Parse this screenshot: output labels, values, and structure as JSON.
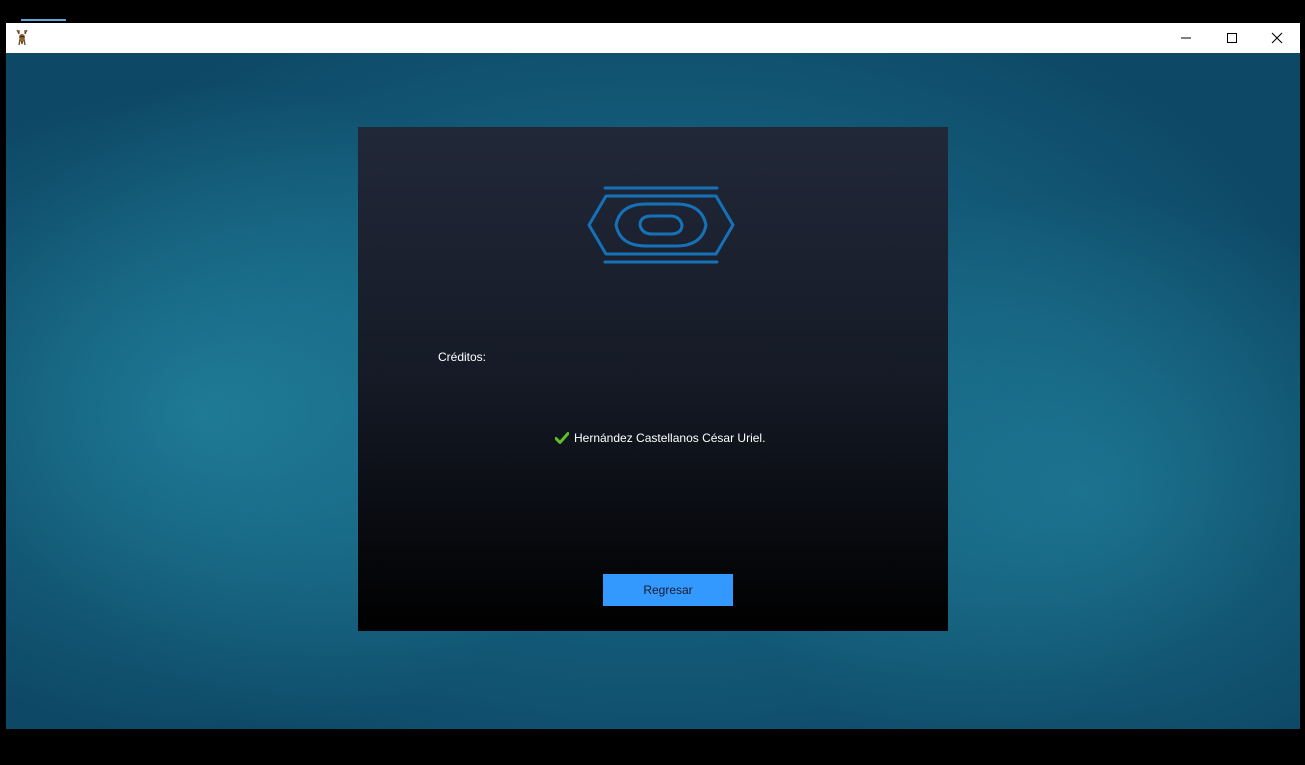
{
  "titlebar": {
    "app_icon": "deer-icon",
    "minimize_icon": "minimize-icon",
    "maximize_icon": "maximize-icon",
    "close_icon": "close-icon"
  },
  "panel": {
    "logo_icon": "logo-icon",
    "credits_label": "Créditos:",
    "credit_entries": [
      {
        "icon": "check-icon",
        "name": "Hernández Castellanos César Uriel."
      }
    ],
    "back_button_label": "Regresar"
  },
  "colors": {
    "accent_button": "#3399ff",
    "logo_stroke": "#1672b8",
    "check": "#5fbf2a",
    "panel_top": "#212838",
    "panel_bottom": "#000000",
    "background": "#135a78"
  }
}
